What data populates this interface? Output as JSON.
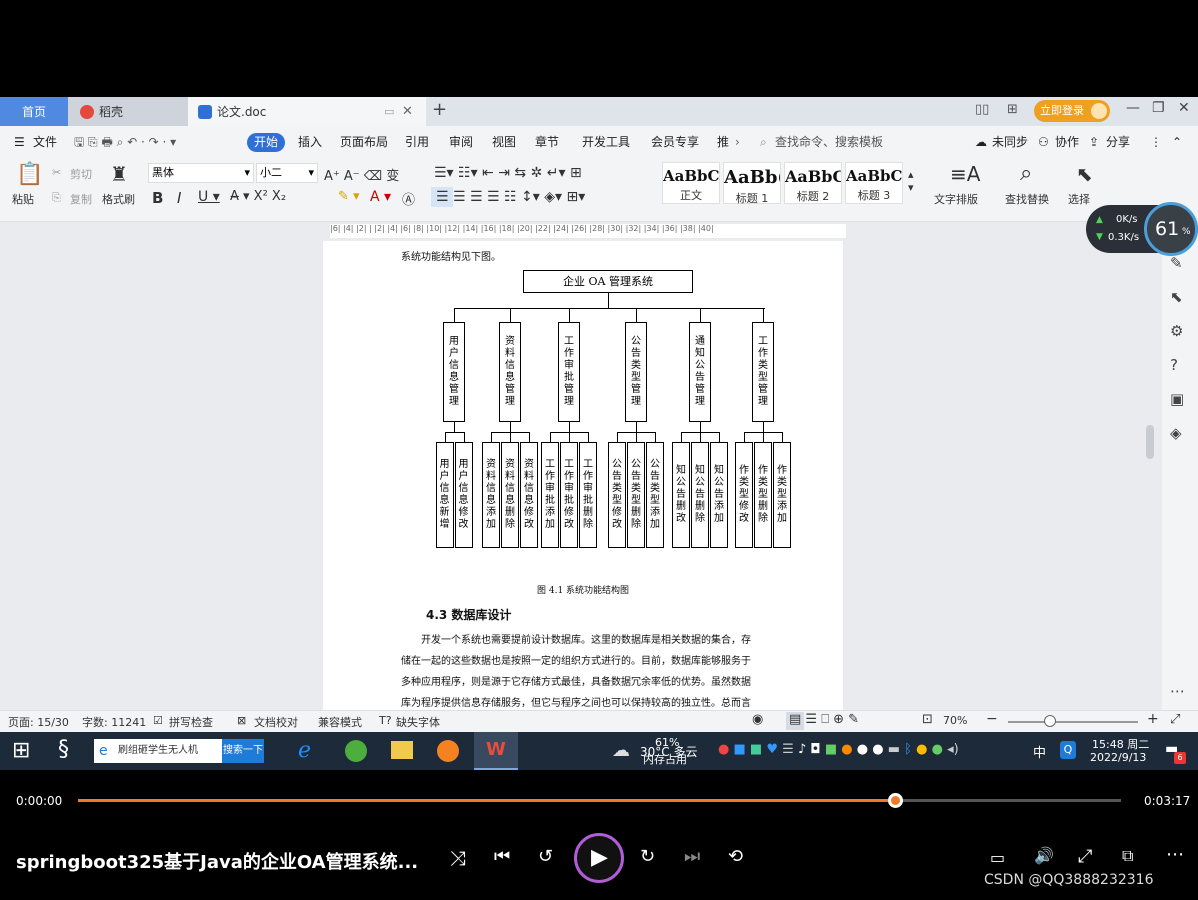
{
  "tabs": {
    "home": "首页",
    "daoke": "稻壳",
    "doc": "论文.doc",
    "login": "立即登录"
  },
  "menu": {
    "file": "文件",
    "items": [
      "开始",
      "插入",
      "页面布局",
      "引用",
      "审阅",
      "视图",
      "章节",
      "开发工具",
      "会员专享",
      "推"
    ],
    "search_placeholder": "查找命令、搜索模板",
    "unsync": "未同步",
    "collab": "协作",
    "share": "分享"
  },
  "ribbon": {
    "paste": "粘贴",
    "cut": "剪切",
    "copy": "复制",
    "format_painter": "格式刷",
    "font_name": "黑体",
    "font_size": "小二",
    "styles": [
      {
        "sample": "AaBbCcI",
        "name": "正文"
      },
      {
        "sample": "AaBb(",
        "name": "标题 1"
      },
      {
        "sample": "AaBbC",
        "name": "标题 2"
      },
      {
        "sample": "AaBbCc",
        "name": "标题 3"
      }
    ],
    "text_layout": "文字排版",
    "find_replace": "查找替换",
    "select": "选择"
  },
  "ruler": "|6| |4| |2| | |2| |4| |6| |8| |10| |12| |14| |16| |18| |20| |22| |24| |26| |28| |30| |32| |34| |36| |38| |40|",
  "speed": {
    "up": "0K/s",
    "down": "0.3K/s",
    "percent": "61",
    "pct_sign": "%"
  },
  "document": {
    "intro": "系统功能结构见下图。",
    "root": "企业 OA 管理系统",
    "modules": [
      {
        "name": "用户信息管理",
        "subs": [
          "用户信息新增",
          "用户信息修改"
        ]
      },
      {
        "name": "资料信息管理",
        "subs": [
          "资料信息添加",
          "资料信息删除",
          "资料信息修改"
        ]
      },
      {
        "name": "工作审批管理",
        "subs": [
          "工作审批添加",
          "工作审批修改",
          "工作审批删除"
        ]
      },
      {
        "name": "公告类型管理",
        "subs": [
          "公告类型修改",
          "公告类型删除",
          "公告类型添加"
        ]
      },
      {
        "name": "通知公告管理",
        "subs": [
          "知公告删改",
          "知公告删除",
          "知公告添加"
        ]
      },
      {
        "name": "工作类型管理",
        "subs": [
          "作类型修改",
          "作类型删除",
          "作类型添加"
        ]
      }
    ],
    "caption": "图 4.1  系统功能结构图",
    "heading": "4.3  数据库设计",
    "para": [
      "开发一个系统也需要提前设计数据库。这里的数据库是相关数据的集合，存",
      "储在一起的这些数据也是按照一定的组织方式进行的。目前，数据库能够服务于",
      "多种应用程序，则是源于它存储方式最佳，具备数据冗余率低的优势。虽然数据",
      "库为程序提供信息存储服务，但它与程序之间也可以保持较高的独立性。总而言"
    ]
  },
  "status": {
    "page": "页面: 15/30",
    "words": "字数: 11241",
    "spell": "拼写检查",
    "proof": "文档校对",
    "compat": "兼容模式",
    "font_missing": "缺失字体",
    "zoom": "70%"
  },
  "taskbar": {
    "search_text": "刷组砸学生无人机",
    "search_btn": "搜索一下",
    "weather": "30°C 多云",
    "mem_pct": "61%",
    "mem_label": "内存占用",
    "ime": "中",
    "time": "15:48 周二",
    "date": "2022/9/13",
    "badge": "6"
  },
  "player": {
    "current": "0:00:00",
    "duration": "0:03:17",
    "progress": 0.783,
    "title": "springboot325基于Java的企业OA管理系统...",
    "watermark": "CSDN @QQ3888232316"
  }
}
